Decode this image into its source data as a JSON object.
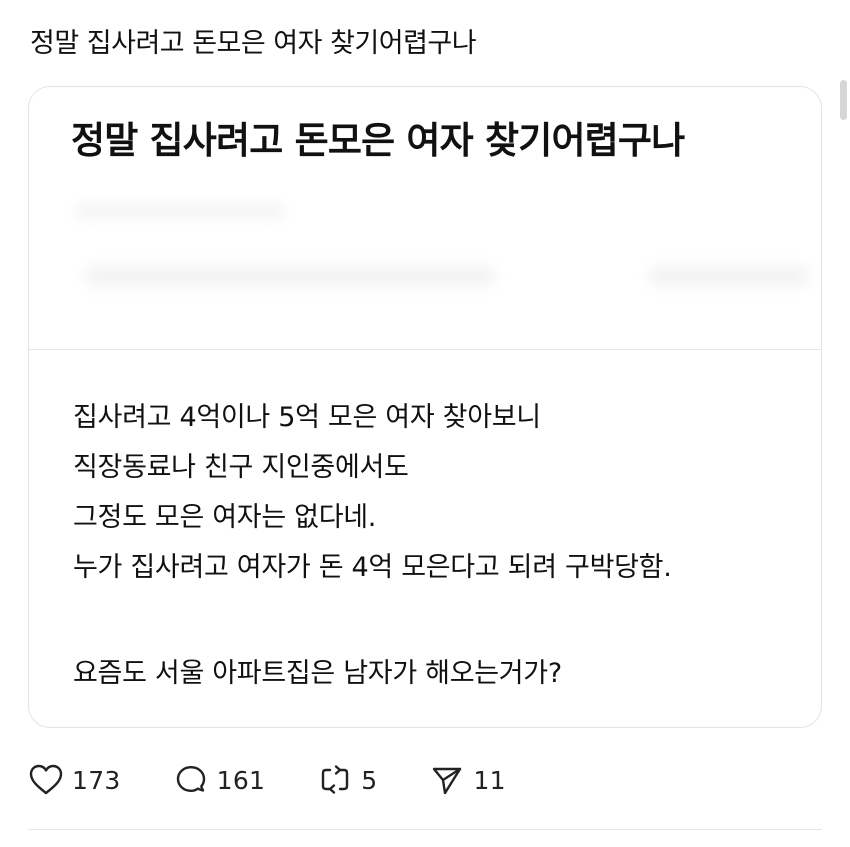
{
  "post": {
    "title": "정말 집사려고 돈모은 여자 찾기어렵구나"
  },
  "card": {
    "title": "정말 집사려고 돈모은 여자 찾기어렵구나",
    "body": {
      "lines": [
        "집사려고 4억이나 5억 모은 여자 찾아보니",
        "직장동료나 친구 지인중에서도",
        "그정도 모은 여자는 없다네.",
        "누가 집사려고 여자가 돈 4억 모은다고 되려 구박당함."
      ],
      "closing": "요즘도 서울 아파트집은 남자가 해오는거가?"
    }
  },
  "actions": {
    "likes": "173",
    "replies": "161",
    "reposts": "5",
    "shares": "11"
  },
  "icons": {
    "like": "heart-icon",
    "reply": "comment-bubble-icon",
    "repost": "repost-icon",
    "share": "send-icon"
  },
  "colors": {
    "text": "#111111",
    "border": "#e3e3e3",
    "icon": "#222222"
  }
}
